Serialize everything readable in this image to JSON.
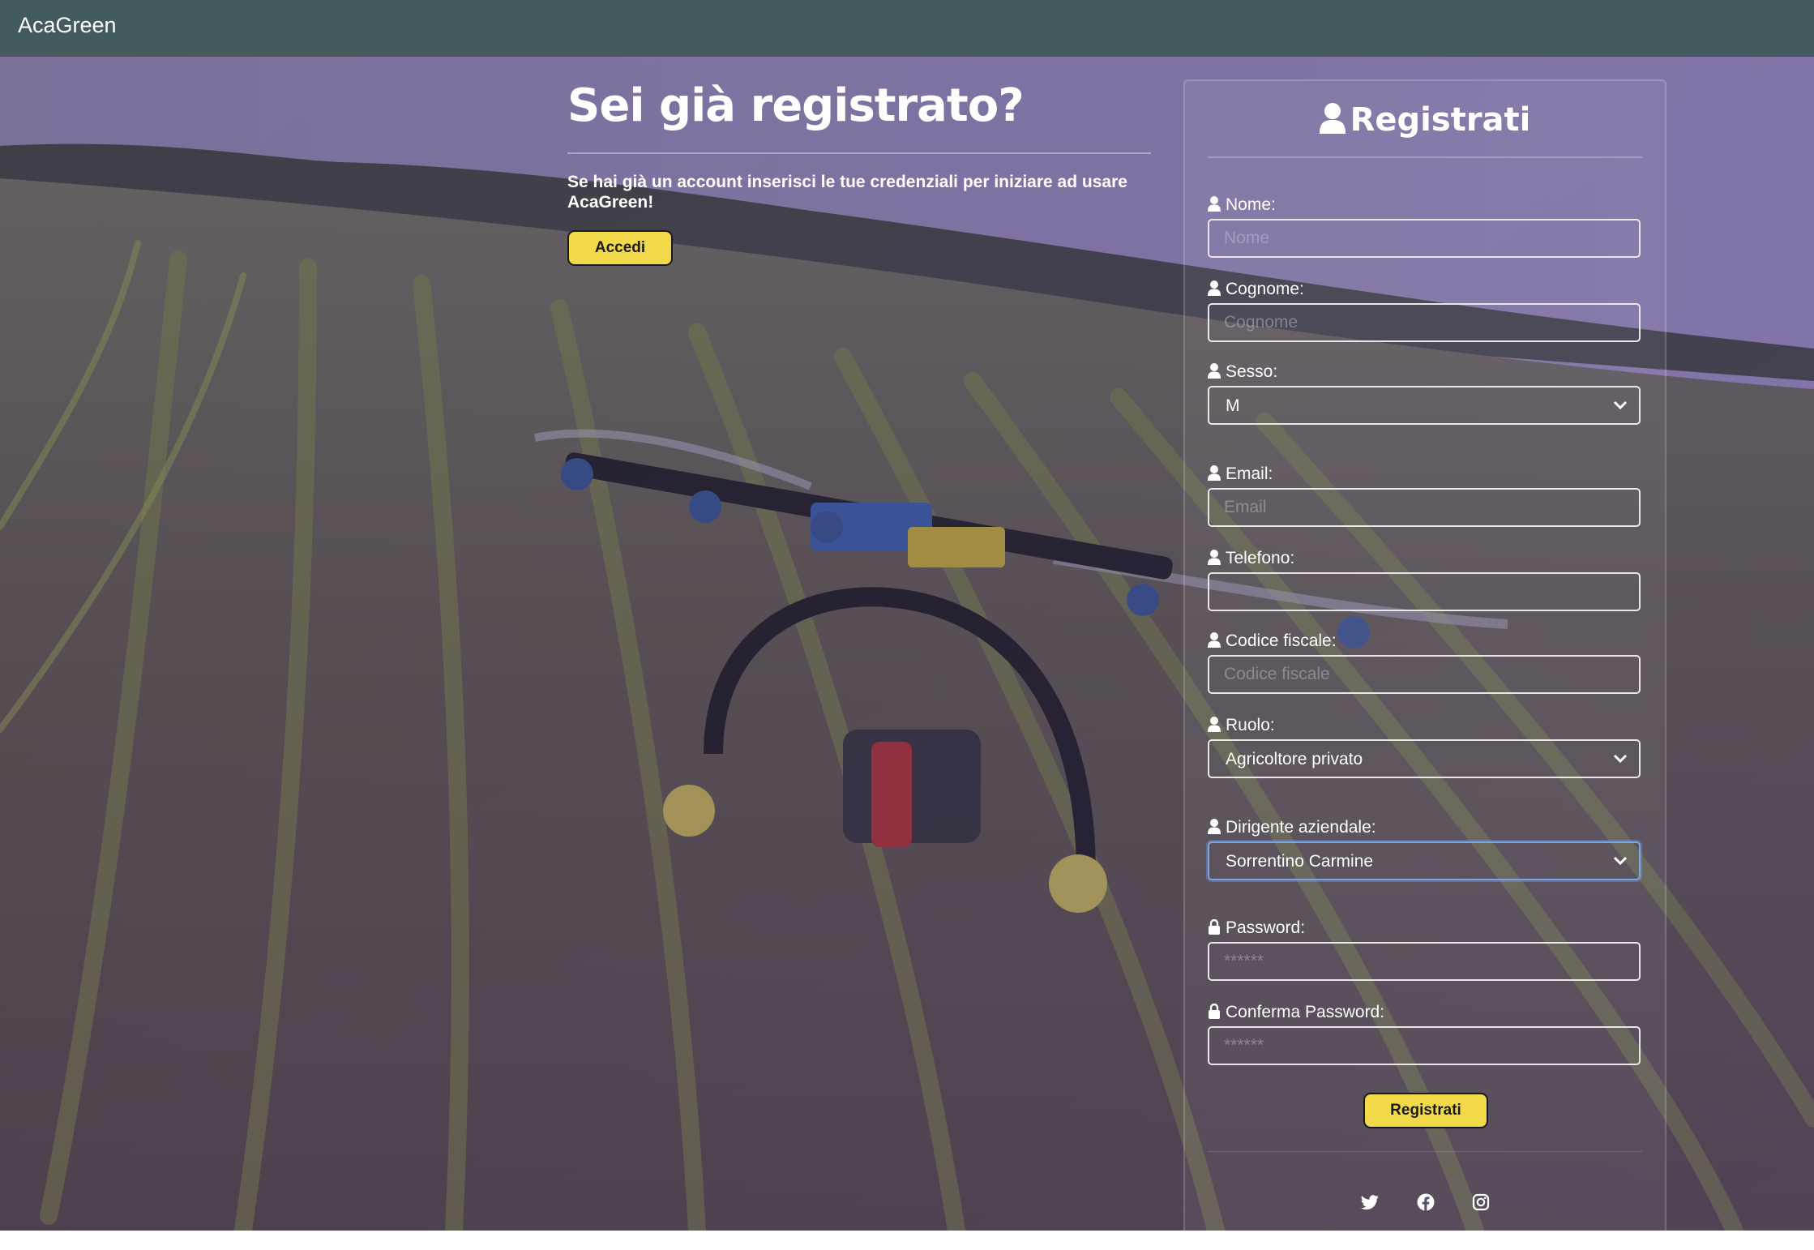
{
  "navbar": {
    "brand": "AcaGreen"
  },
  "login": {
    "title": "Sei già registrato?",
    "text": "Se hai già un account inserisci le tue credenziali per iniziare ad usare AcaGreen!",
    "button": "Accedi"
  },
  "register": {
    "title": "Registrati",
    "fields": {
      "nome": {
        "label": "Nome:",
        "placeholder": "Nome"
      },
      "cognome": {
        "label": "Cognome:",
        "placeholder": "Cognome"
      },
      "sesso": {
        "label": "Sesso:",
        "value": "M"
      },
      "email": {
        "label": "Email:",
        "placeholder": "Email"
      },
      "telefono": {
        "label": "Telefono:",
        "placeholder": ""
      },
      "codice_fiscale": {
        "label": "Codice fiscale:",
        "placeholder": "Codice fiscale"
      },
      "ruolo": {
        "label": "Ruolo:",
        "value": "Agricoltore privato"
      },
      "dirigente": {
        "label": "Dirigente aziendale:",
        "value": "Sorrentino Carmine"
      },
      "password": {
        "label": "Password:",
        "placeholder": "******"
      },
      "conferma_password": {
        "label": "Conferma Password:",
        "placeholder": "******"
      }
    },
    "submit": "Registrati"
  },
  "social_icons": [
    "twitter-icon",
    "facebook-icon",
    "instagram-icon"
  ],
  "colors": {
    "navbar": "#435b5d",
    "button": "#f1d949",
    "overlay": "#8a7fb0"
  }
}
